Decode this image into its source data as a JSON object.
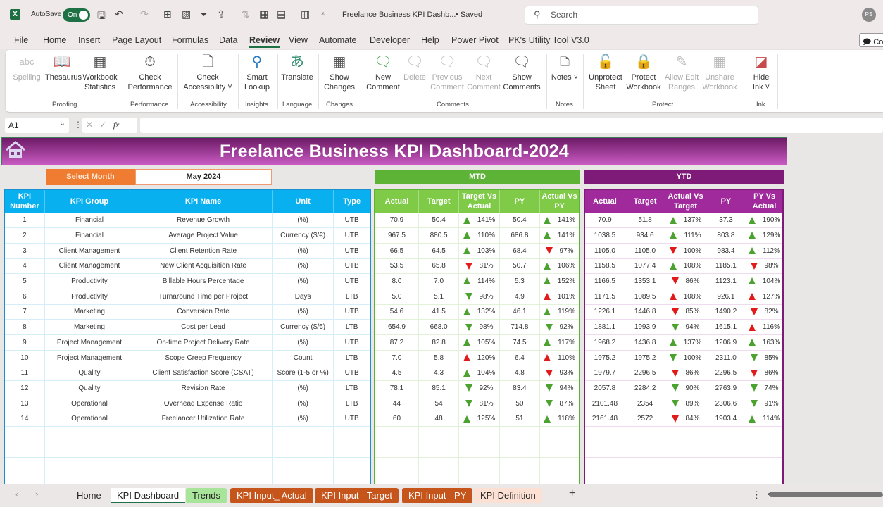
{
  "titlebar": {
    "autosave_label": "AutoSave",
    "autosave_state": "On",
    "document_title": "Freelance Business KPI Dashb...",
    "save_status": "• Saved",
    "search_placeholder": "Search",
    "user_initials": "PS"
  },
  "menu": {
    "items": [
      "File",
      "Home",
      "Insert",
      "Page Layout",
      "Formulas",
      "Data",
      "Review",
      "View",
      "Automate",
      "Developer",
      "Help",
      "Power Pivot",
      "PK's Utility Tool V3.0"
    ],
    "active": "Review",
    "comments_button": "Co"
  },
  "ribbon": {
    "buttons": [
      {
        "label": "Spelling",
        "icon": "spelling-icon",
        "disabled": true
      },
      {
        "label": "Thesaurus",
        "icon": "thesaurus-icon",
        "disabled": false
      },
      {
        "label": "Workbook Statistics",
        "icon": "workbook-statistics-icon",
        "disabled": false
      },
      {
        "label": "Check Performance",
        "icon": "check-performance-icon",
        "disabled": false
      },
      {
        "label": "Check Accessibility ˅",
        "icon": "check-accessibility-icon",
        "disabled": false
      },
      {
        "label": "Smart Lookup",
        "icon": "smart-lookup-icon",
        "disabled": false
      },
      {
        "label": "Translate",
        "icon": "translate-icon",
        "disabled": false
      },
      {
        "label": "Show Changes",
        "icon": "show-changes-icon",
        "disabled": false
      },
      {
        "label": "New Comment",
        "icon": "new-comment-icon",
        "disabled": false
      },
      {
        "label": "Delete",
        "icon": "delete-comment-icon",
        "disabled": true
      },
      {
        "label": "Previous Comment",
        "icon": "previous-comment-icon",
        "disabled": true
      },
      {
        "label": "Next Comment",
        "icon": "next-comment-icon",
        "disabled": true
      },
      {
        "label": "Show Comments",
        "icon": "show-comments-icon",
        "disabled": false
      },
      {
        "label": "Notes ˅",
        "icon": "notes-icon",
        "disabled": false
      },
      {
        "label": "Unprotect Sheet",
        "icon": "unprotect-sheet-icon",
        "disabled": false
      },
      {
        "label": "Protect Workbook",
        "icon": "protect-workbook-icon",
        "disabled": false
      },
      {
        "label": "Allow Edit Ranges",
        "icon": "allow-edit-ranges-icon",
        "disabled": true
      },
      {
        "label": "Unshare Workbook",
        "icon": "unshare-workbook-icon",
        "disabled": true
      },
      {
        "label": "Hide Ink ˅",
        "icon": "hide-ink-icon",
        "disabled": false
      }
    ],
    "groups": [
      "Proofing",
      "Performance",
      "Accessibility",
      "Insights",
      "Language",
      "Changes",
      "Comments",
      "Notes",
      "Protect",
      "Ink"
    ]
  },
  "formula_bar": {
    "name_box": "A1",
    "formula": ""
  },
  "dashboard": {
    "title": "Freelance Business KPI Dashboard-2024",
    "select_month_label": "Select Month",
    "selected_month": "May 2024",
    "mtd_label": "MTD",
    "ytd_label": "YTD",
    "colors": {
      "kpi_header": "#08b0ef",
      "mtd": "#5cb336",
      "ytd": "#7e1b78",
      "select_month": "#ef7c31",
      "banner": "#a0359a",
      "good": "#4ca22f",
      "bad": "#e21a1a"
    },
    "kpi_headers": [
      "KPI Number",
      "KPI Group",
      "KPI Name",
      "Unit",
      "Type"
    ],
    "mtd_headers": [
      "Actual",
      "Target",
      "Target Vs Actual",
      "PY",
      "Actual Vs PY"
    ],
    "ytd_headers": [
      "Actual",
      "Target",
      "Actual Vs Target",
      "PY",
      "PY Vs Actual"
    ],
    "rows": [
      {
        "num": "1",
        "group": "Financial",
        "name": "Revenue Growth",
        "unit": "(%)",
        "type": "UTB",
        "mtd": {
          "actual": "70.9",
          "target": "50.4",
          "tva": "141%",
          "tva_arrow": "up-green",
          "py": "50.4",
          "avp": "141%",
          "avp_arrow": "up-green"
        },
        "ytd": {
          "actual": "70.9",
          "target": "51.8",
          "avt": "137%",
          "avt_arrow": "up-green",
          "py": "37.3",
          "pva": "190%",
          "pva_arrow": "up-green"
        }
      },
      {
        "num": "2",
        "group": "Financial",
        "name": "Average Project Value",
        "unit": "Currency ($/€)",
        "type": "UTB",
        "mtd": {
          "actual": "967.5",
          "target": "880.5",
          "tva": "110%",
          "tva_arrow": "up-green",
          "py": "686.8",
          "avp": "141%",
          "avp_arrow": "up-green"
        },
        "ytd": {
          "actual": "1038.5",
          "target": "934.6",
          "avt": "111%",
          "avt_arrow": "up-green",
          "py": "803.8",
          "pva": "129%",
          "pva_arrow": "up-green"
        }
      },
      {
        "num": "3",
        "group": "Client Management",
        "name": "Client Retention Rate",
        "unit": "(%)",
        "type": "UTB",
        "mtd": {
          "actual": "66.5",
          "target": "64.5",
          "tva": "103%",
          "tva_arrow": "up-green",
          "py": "68.4",
          "avp": "97%",
          "avp_arrow": "down-red"
        },
        "ytd": {
          "actual": "1105.0",
          "target": "1105.0",
          "avt": "100%",
          "avt_arrow": "down-red",
          "py": "983.4",
          "pva": "112%",
          "pva_arrow": "up-green"
        }
      },
      {
        "num": "4",
        "group": "Client Management",
        "name": "New Client Acquisition Rate",
        "unit": "(%)",
        "type": "UTB",
        "mtd": {
          "actual": "53.5",
          "target": "65.8",
          "tva": "81%",
          "tva_arrow": "down-red",
          "py": "50.7",
          "avp": "106%",
          "avp_arrow": "up-green"
        },
        "ytd": {
          "actual": "1158.5",
          "target": "1077.4",
          "avt": "108%",
          "avt_arrow": "up-green",
          "py": "1185.1",
          "pva": "98%",
          "pva_arrow": "down-red"
        }
      },
      {
        "num": "5",
        "group": "Productivity",
        "name": "Billable Hours Percentage",
        "unit": "(%)",
        "type": "UTB",
        "mtd": {
          "actual": "8.0",
          "target": "7.0",
          "tva": "114%",
          "tva_arrow": "up-green",
          "py": "5.3",
          "avp": "152%",
          "avp_arrow": "up-green"
        },
        "ytd": {
          "actual": "1166.5",
          "target": "1353.1",
          "avt": "86%",
          "avt_arrow": "down-red",
          "py": "1123.1",
          "pva": "104%",
          "pva_arrow": "up-green"
        }
      },
      {
        "num": "6",
        "group": "Productivity",
        "name": "Turnaround Time per Project",
        "unit": "Days",
        "type": "LTB",
        "mtd": {
          "actual": "5.0",
          "target": "5.1",
          "tva": "98%",
          "tva_arrow": "down-green",
          "py": "4.9",
          "avp": "101%",
          "avp_arrow": "up-red"
        },
        "ytd": {
          "actual": "1171.5",
          "target": "1089.5",
          "avt": "108%",
          "avt_arrow": "up-red",
          "py": "926.1",
          "pva": "127%",
          "pva_arrow": "up-red"
        }
      },
      {
        "num": "7",
        "group": "Marketing",
        "name": "Conversion Rate",
        "unit": "(%)",
        "type": "UTB",
        "mtd": {
          "actual": "54.6",
          "target": "41.5",
          "tva": "132%",
          "tva_arrow": "up-green",
          "py": "46.1",
          "avp": "119%",
          "avp_arrow": "up-green"
        },
        "ytd": {
          "actual": "1226.1",
          "target": "1446.8",
          "avt": "85%",
          "avt_arrow": "down-red",
          "py": "1490.2",
          "pva": "82%",
          "pva_arrow": "down-red"
        }
      },
      {
        "num": "8",
        "group": "Marketing",
        "name": "Cost per Lead",
        "unit": "Currency ($/€)",
        "type": "LTB",
        "mtd": {
          "actual": "654.9",
          "target": "668.0",
          "tva": "98%",
          "tva_arrow": "down-green",
          "py": "714.8",
          "avp": "92%",
          "avp_arrow": "down-green"
        },
        "ytd": {
          "actual": "1881.1",
          "target": "1993.9",
          "avt": "94%",
          "avt_arrow": "down-green",
          "py": "1615.1",
          "pva": "116%",
          "pva_arrow": "up-red"
        }
      },
      {
        "num": "9",
        "group": "Project Management",
        "name": "On-time Project Delivery Rate",
        "unit": "(%)",
        "type": "UTB",
        "mtd": {
          "actual": "87.2",
          "target": "82.8",
          "tva": "105%",
          "tva_arrow": "up-green",
          "py": "74.5",
          "avp": "117%",
          "avp_arrow": "up-green"
        },
        "ytd": {
          "actual": "1968.2",
          "target": "1436.8",
          "avt": "137%",
          "avt_arrow": "up-green",
          "py": "1206.9",
          "pva": "163%",
          "pva_arrow": "up-green"
        }
      },
      {
        "num": "10",
        "group": "Project Management",
        "name": "Scope Creep Frequency",
        "unit": "Count",
        "type": "LTB",
        "mtd": {
          "actual": "7.0",
          "target": "5.8",
          "tva": "120%",
          "tva_arrow": "up-red",
          "py": "6.4",
          "avp": "110%",
          "avp_arrow": "up-red"
        },
        "ytd": {
          "actual": "1975.2",
          "target": "1975.2",
          "avt": "100%",
          "avt_arrow": "down-green",
          "py": "2311.0",
          "pva": "85%",
          "pva_arrow": "down-green"
        }
      },
      {
        "num": "11",
        "group": "Quality",
        "name": "Client Satisfaction Score (CSAT)",
        "unit": "Score (1-5 or %)",
        "type": "UTB",
        "mtd": {
          "actual": "4.5",
          "target": "4.3",
          "tva": "104%",
          "tva_arrow": "up-green",
          "py": "4.8",
          "avp": "93%",
          "avp_arrow": "down-red"
        },
        "ytd": {
          "actual": "1979.7",
          "target": "2296.5",
          "avt": "86%",
          "avt_arrow": "down-red",
          "py": "2296.5",
          "pva": "86%",
          "pva_arrow": "down-red"
        }
      },
      {
        "num": "12",
        "group": "Quality",
        "name": "Revision Rate",
        "unit": "(%)",
        "type": "LTB",
        "mtd": {
          "actual": "78.1",
          "target": "85.1",
          "tva": "92%",
          "tva_arrow": "down-green",
          "py": "83.4",
          "avp": "94%",
          "avp_arrow": "down-green"
        },
        "ytd": {
          "actual": "2057.8",
          "target": "2284.2",
          "avt": "90%",
          "avt_arrow": "down-green",
          "py": "2763.9",
          "pva": "74%",
          "pva_arrow": "down-green"
        }
      },
      {
        "num": "13",
        "group": "Operational",
        "name": "Overhead Expense Ratio",
        "unit": "(%)",
        "type": "LTB",
        "mtd": {
          "actual": "44",
          "target": "54",
          "tva": "81%",
          "tva_arrow": "down-green",
          "py": "50",
          "avp": "87%",
          "avp_arrow": "down-green"
        },
        "ytd": {
          "actual": "2101.48",
          "target": "2354",
          "avt": "89%",
          "avt_arrow": "down-green",
          "py": "2306.6",
          "pva": "91%",
          "pva_arrow": "down-green"
        }
      },
      {
        "num": "14",
        "group": "Operational",
        "name": "Freelancer Utilization Rate",
        "unit": "(%)",
        "type": "UTB",
        "mtd": {
          "actual": "60",
          "target": "48",
          "tva": "125%",
          "tva_arrow": "up-green",
          "py": "51",
          "avp": "118%",
          "avp_arrow": "up-green"
        },
        "ytd": {
          "actual": "2161.48",
          "target": "2572",
          "avt": "84%",
          "avt_arrow": "down-red",
          "py": "1903.4",
          "pva": "114%",
          "pva_arrow": "up-green"
        }
      }
    ]
  },
  "sheet_tabs": [
    {
      "label": "Home",
      "style": "plain"
    },
    {
      "label": "KPI Dashboard",
      "style": "active"
    },
    {
      "label": "Trends",
      "style": "green"
    },
    {
      "label": "KPI Input_ Actual",
      "style": "orange"
    },
    {
      "label": "KPI Input - Target",
      "style": "orange"
    },
    {
      "label": "KPI Input - PY",
      "style": "orange"
    },
    {
      "label": "KPI Definition",
      "style": "peach"
    }
  ]
}
